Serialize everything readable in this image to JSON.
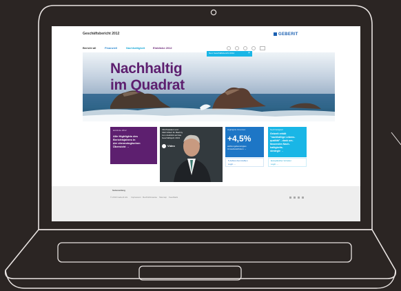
{
  "site": {
    "report_title": "Geschäftsbericht 2012",
    "brand": "GEBERIT",
    "colors": {
      "brand_blue": "#1b60b2",
      "purple": "#5d1f6f",
      "cyan": "#19b6e6",
      "blue": "#1d76c6",
      "footer_bg": "#eeeeee"
    }
  },
  "nav": {
    "items": [
      {
        "label": "Bericht all",
        "color": "#333333"
      },
      {
        "label": "Finanziell",
        "color": "#2f8ad0"
      },
      {
        "label": "Nachhaltigkeit",
        "color": "#19a8d6"
      },
      {
        "label": "Einblicke 2012",
        "color": "#6b2877"
      }
    ],
    "utility_icons": [
      "search-icon",
      "print-icon",
      "info-icon",
      "download-icon",
      "language-switch-icon"
    ],
    "dropdown_text": "Neu: Geschäftsbericht 2012",
    "dropdown_close": "×"
  },
  "hero": {
    "headline_line1": "Nachhaltig",
    "headline_line2": "im Quadrat"
  },
  "tiles": {
    "highlights": {
      "kicker": "Einblicke 2012",
      "text_lines": [
        "Alle Highlights des",
        "Berichtsjahres in",
        "der chronologischen",
        "Übersicht →"
      ]
    },
    "video": {
      "caption_lines": [
        "VR-Präsident und",
        "CEO Albert M. Baehny",
        "zum Ausblick auf das",
        "Geschäftsjahr 2013"
      ],
      "label": "Video"
    },
    "figures": {
      "kicker": "Highlights Finanzen",
      "value": "+4,5%",
      "desc_lines": [
        "währungsbereinigtes",
        "Umsatzwachstum →"
      ],
      "sub": "5-Jahres-Kennzahlen",
      "sub_link": "Login →"
    },
    "sustainability": {
      "kicker": "Nachhaltigkeit",
      "text_lines": [
        "Geberit erhält",
        "\"nachhaltige Lebens-",
        "qualität\" - dank um-",
        "fassenden Nach-",
        "haltigkeits-",
        "strategie →"
      ],
      "sub": "Europäischer Vorreiter",
      "sub_link": "Login →"
    }
  },
  "footer": {
    "toggle": "Seitenanfang",
    "links": [
      "© 2013 Geberit AG",
      "Impressum",
      "Rechtshinweise",
      "Sitemap",
      "Feedback"
    ],
    "social_icons": [
      "facebook-icon",
      "twitter-icon",
      "google-plus-icon",
      "share-icon"
    ]
  }
}
